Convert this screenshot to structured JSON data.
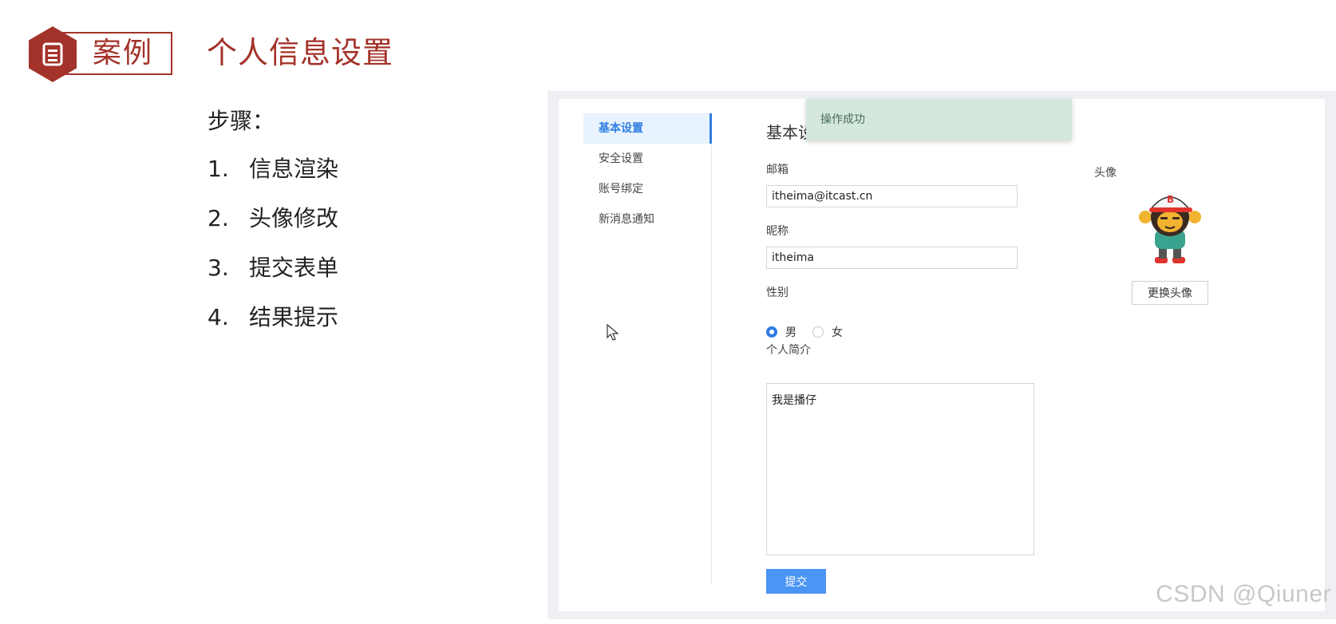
{
  "header": {
    "badge_label": "案例",
    "title": "个人信息设置"
  },
  "steps": {
    "heading": "步骤：",
    "items": [
      {
        "num": "1.",
        "text": "信息渲染"
      },
      {
        "num": "2.",
        "text": "头像修改"
      },
      {
        "num": "3.",
        "text": "提交表单"
      },
      {
        "num": "4.",
        "text": "结果提示"
      }
    ]
  },
  "app": {
    "menu": [
      {
        "label": "基本设置",
        "active": true
      },
      {
        "label": "安全设置",
        "active": false
      },
      {
        "label": "账号绑定",
        "active": false
      },
      {
        "label": "新消息通知",
        "active": false
      }
    ],
    "section_title": "基本设",
    "toast": "操作成功",
    "form": {
      "email_label": "邮箱",
      "email_value": "itheima@itcast.cn",
      "nickname_label": "昵称",
      "nickname_value": "itheima",
      "gender_label": "性别",
      "gender_options": [
        "男",
        "女"
      ],
      "gender_selected": "男",
      "bio_label": "个人简介",
      "bio_value": "我是播仔",
      "submit_label": "提交"
    },
    "avatar": {
      "label": "头像",
      "change_label": "更换头像"
    },
    "accent_color": "#2f7de1"
  },
  "watermark": "CSDN @Qiuner"
}
